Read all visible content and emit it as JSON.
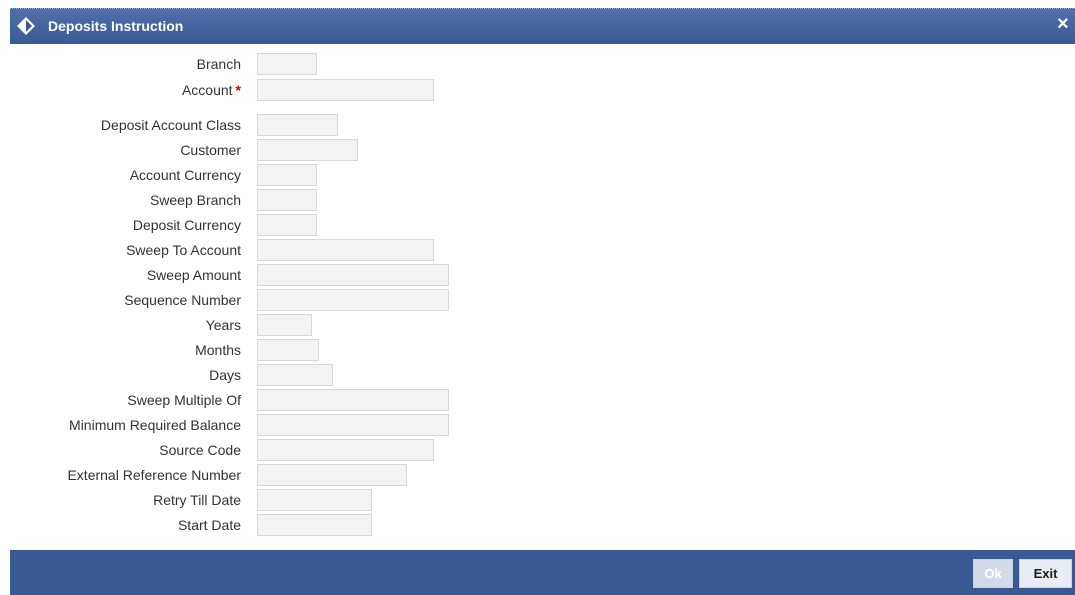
{
  "window": {
    "title": "Deposits Instruction",
    "close_glyph": "×"
  },
  "icons": {
    "title": "diamond-arrow-icon",
    "close": "close-icon"
  },
  "colors": {
    "titlebar": "#3a5a96",
    "footer": "#3a5a96",
    "required": "#cc0000"
  },
  "fields": {
    "branch": {
      "label": "Branch",
      "value": ""
    },
    "account": {
      "label": "Account",
      "required_mark": "*",
      "value": ""
    },
    "deposit_account_class": {
      "label": "Deposit Account Class",
      "value": ""
    },
    "customer": {
      "label": "Customer",
      "value": ""
    },
    "account_currency": {
      "label": "Account Currency",
      "value": ""
    },
    "sweep_branch": {
      "label": "Sweep Branch",
      "value": ""
    },
    "deposit_currency": {
      "label": "Deposit Currency",
      "value": ""
    },
    "sweep_to_account": {
      "label": "Sweep To Account",
      "value": ""
    },
    "sweep_amount": {
      "label": "Sweep Amount",
      "value": ""
    },
    "sequence_number": {
      "label": "Sequence Number",
      "value": ""
    },
    "years": {
      "label": "Years",
      "value": ""
    },
    "months": {
      "label": "Months",
      "value": ""
    },
    "days": {
      "label": "Days",
      "value": ""
    },
    "sweep_multiple_of": {
      "label": "Sweep Multiple Of",
      "value": ""
    },
    "minimum_required_balance": {
      "label": "Minimum Required Balance",
      "value": ""
    },
    "source_code": {
      "label": "Source Code",
      "value": ""
    },
    "external_reference_number": {
      "label": "External Reference Number",
      "value": ""
    },
    "retry_till_date": {
      "label": "Retry Till Date",
      "value": ""
    },
    "start_date": {
      "label": "Start Date",
      "value": ""
    }
  },
  "footer": {
    "ok_label": "Ok",
    "exit_label": "Exit"
  }
}
